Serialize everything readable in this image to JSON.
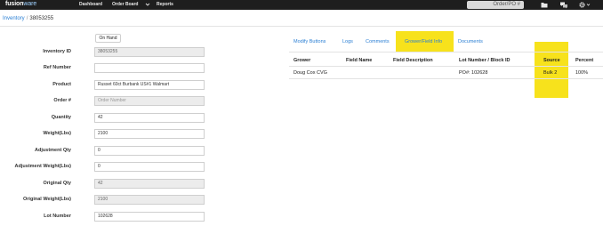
{
  "app": {
    "logo_main": "fusion",
    "logo_accent": "ware"
  },
  "nav": {
    "dashboard": "Dashboard",
    "order_board": "Order Board",
    "reports": "Reports",
    "search_placeholder": "Order/PO #"
  },
  "breadcrumb": {
    "link": "Inventory",
    "separator": "/",
    "current": "38053255"
  },
  "form": {
    "status_button": "On Hand",
    "fields": [
      {
        "label": "Inventory ID",
        "value": "38053255",
        "readonly": true
      },
      {
        "label": "Ref Number",
        "value": "",
        "readonly": false
      },
      {
        "label": "Product",
        "value": "Russet 60ct Burbank US#1 Walmart",
        "readonly": false
      },
      {
        "label": "Order #",
        "value": "Order Number",
        "readonly": true
      },
      {
        "label": "Quantity",
        "value": "42",
        "readonly": false
      },
      {
        "label": "Weight(Lbs)",
        "value": "2100",
        "readonly": false
      },
      {
        "label": "Adjustment Qty",
        "value": "0",
        "readonly": false
      },
      {
        "label": "Adjustment Weight(Lbs)",
        "value": "0",
        "readonly": false
      },
      {
        "label": "Original Qty",
        "value": "42",
        "readonly": true
      },
      {
        "label": "Original Weight(Lbs)",
        "value": "2100",
        "readonly": true
      },
      {
        "label": "Lot Number",
        "value": "102628",
        "readonly": false
      }
    ]
  },
  "tabs": [
    "Modify Buttons",
    "Logs",
    "Comments",
    "Grower/Field Info",
    "Documents"
  ],
  "table": {
    "headers": [
      "Grower",
      "Field Name",
      "Field Description",
      "Lot Number / Block ID",
      "Source",
      "Percent"
    ],
    "rows": [
      [
        "Doug Cox CVG",
        "",
        "",
        "PO#: 102628",
        "Bulk 2",
        "100%"
      ]
    ]
  },
  "colors": {
    "topbar": "#1e1e1e",
    "link": "#2a7fd4",
    "highlight": "#f7e21c"
  },
  "icons": [
    "chevron-down-icon",
    "folder-icon",
    "chat-icon",
    "gear-icon"
  ]
}
